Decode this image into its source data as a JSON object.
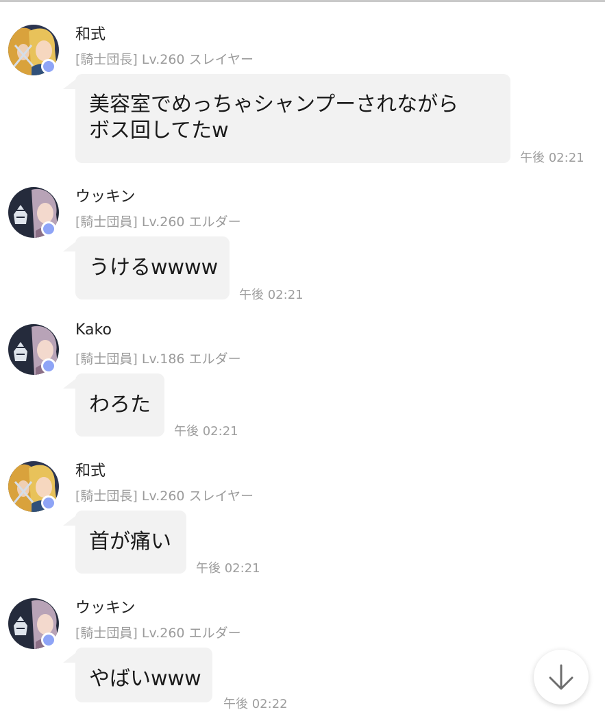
{
  "messages": [
    {
      "name": "和式",
      "rank": "[騎士団長] Lv.260 スレイヤー",
      "lines": [
        "美容室でめっちゃシャンプーされながら",
        "ボス回してたw"
      ],
      "time": "午後 02:21"
    },
    {
      "name": "ウッキン",
      "rank": "[騎士団員] Lv.260 エルダー",
      "lines": [
        "うけるwwww"
      ],
      "time": "午後 02:21"
    },
    {
      "name": "Kako",
      "rank": "[騎士団員] Lv.186 エルダー",
      "lines": [
        "わろた"
      ],
      "time": "午後 02:21"
    },
    {
      "name": "和式",
      "rank": "[騎士団長] Lv.260 スレイヤー",
      "lines": [
        "首が痛い"
      ],
      "time": "午後 02:21"
    },
    {
      "name": "ウッキン",
      "rank": "[騎士団員] Lv.260 エルダー",
      "lines": [
        "やばいwww"
      ],
      "time": "午後 02:22"
    }
  ],
  "scroll_button": {
    "icon": "arrow-down-icon"
  },
  "colors": {
    "online_dot": "#8ea4f6",
    "bubble": "#f2f2f2",
    "meta_text": "#9b9b9b"
  }
}
